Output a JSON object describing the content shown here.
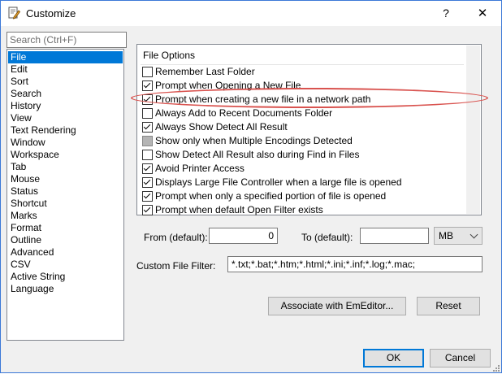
{
  "window": {
    "title": "Customize",
    "help_glyph": "?",
    "close_glyph": "✕",
    "app_icon": "document-pencil-icon"
  },
  "search": {
    "placeholder": "Search (Ctrl+F)"
  },
  "categories": {
    "selected": "File",
    "items": [
      "File",
      "Edit",
      "Sort",
      "Search",
      "History",
      "View",
      "Text Rendering",
      "Window",
      "Workspace",
      "Tab",
      "Mouse",
      "Status",
      "Shortcut",
      "Marks",
      "Format",
      "Outline",
      "Advanced",
      "CSV",
      "Active String",
      "Language"
    ]
  },
  "options": {
    "header": "File Options",
    "items": [
      {
        "label": "Remember Last Folder",
        "state": "unchecked"
      },
      {
        "label": "Prompt when Opening a New File",
        "state": "checked"
      },
      {
        "label": "Prompt when creating a new file in a network path",
        "state": "checked"
      },
      {
        "label": "Always Add to Recent Documents Folder",
        "state": "unchecked"
      },
      {
        "label": "Always Show Detect All Result",
        "state": "checked"
      },
      {
        "label": "Show only when Multiple Encodings Detected",
        "state": "indeterminate"
      },
      {
        "label": "Show Detect All Result also during Find in Files",
        "state": "unchecked"
      },
      {
        "label": "Avoid Printer Access",
        "state": "checked"
      },
      {
        "label": "Displays Large File Controller when a large file is opened",
        "state": "checked"
      },
      {
        "label": "Prompt when only a specified portion of file is opened",
        "state": "checked"
      },
      {
        "label": "Prompt when default Open Filter exists",
        "state": "checked"
      }
    ],
    "highlighted_index": 2,
    "highlight_color": "#d9534f"
  },
  "range": {
    "from_label": "From (default):",
    "from_value": "0",
    "to_label": "To (default):",
    "to_value": "",
    "unit": "MB"
  },
  "filter": {
    "label": "Custom File Filter:",
    "value": "*.txt;*.bat;*.htm;*.html;*.ini;*.inf;*.log;*.mac;"
  },
  "buttons": {
    "associate": "Associate with EmEditor...",
    "reset": "Reset",
    "ok": "OK",
    "cancel": "Cancel"
  },
  "colors": {
    "selection": "#0078d7",
    "window_border": "#3b78d7"
  }
}
